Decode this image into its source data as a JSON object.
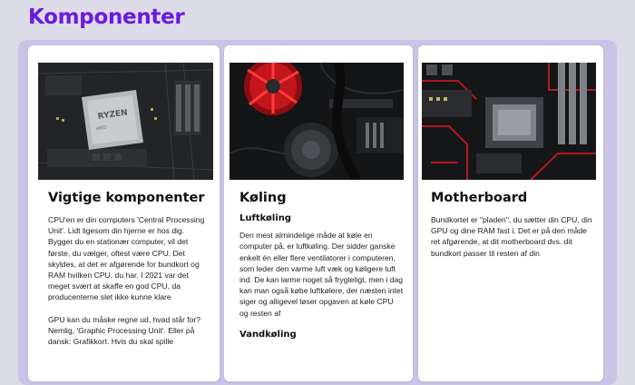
{
  "page": {
    "title": "Komponenter"
  },
  "cards": [
    {
      "title": "Vigtige komponenter",
      "image": "cpu-photo",
      "paragraphs": [
        "CPU'en er din computers 'Central Processing Unit'. Lidt ligesom din hjerne er hos dig. Bygger du en stationær computer, vil det første, du vælger, oftest være CPU. Det skyldes, at det er afgørende for bundkort og RAM hvilken CPU, du har. I 2021 var det meget svært at skaffe en god CPU, da producenterne slet ikke kunne klare",
        "GPU kan du måske regne ud, hvad står for? Nemlig, 'Graphic Processing Unit'. Eller på dansk: Grafikkort. Hvis du skal spille"
      ]
    },
    {
      "title": "Køling",
      "image": "cooling-fan-photo",
      "sections": [
        {
          "heading": "Luftkøling",
          "text": "Den mest almindelige måde at køle en computer på, er luftkøling. Der sidder ganske enkelt én eller flere ventilatorer i computeren, som leder den varme luft væk og køligere luft ind. De kan larme noget så frygteligt, men i dag kan man også købe luftkølere, der næsten intet siger og alligevel løser opgaven at køle CPU og resten af"
        },
        {
          "heading": "Vandkøling",
          "text": ""
        }
      ]
    },
    {
      "title": "Motherboard",
      "image": "motherboard-photo",
      "paragraphs": [
        "Bundkortet er \"pladen\", du sætter din CPU, din GPU og dine RAM fast i. Det er på den måde ret afgørende, at dit motherboard dvs. dit bundkort passer til resten af din"
      ]
    }
  ]
}
